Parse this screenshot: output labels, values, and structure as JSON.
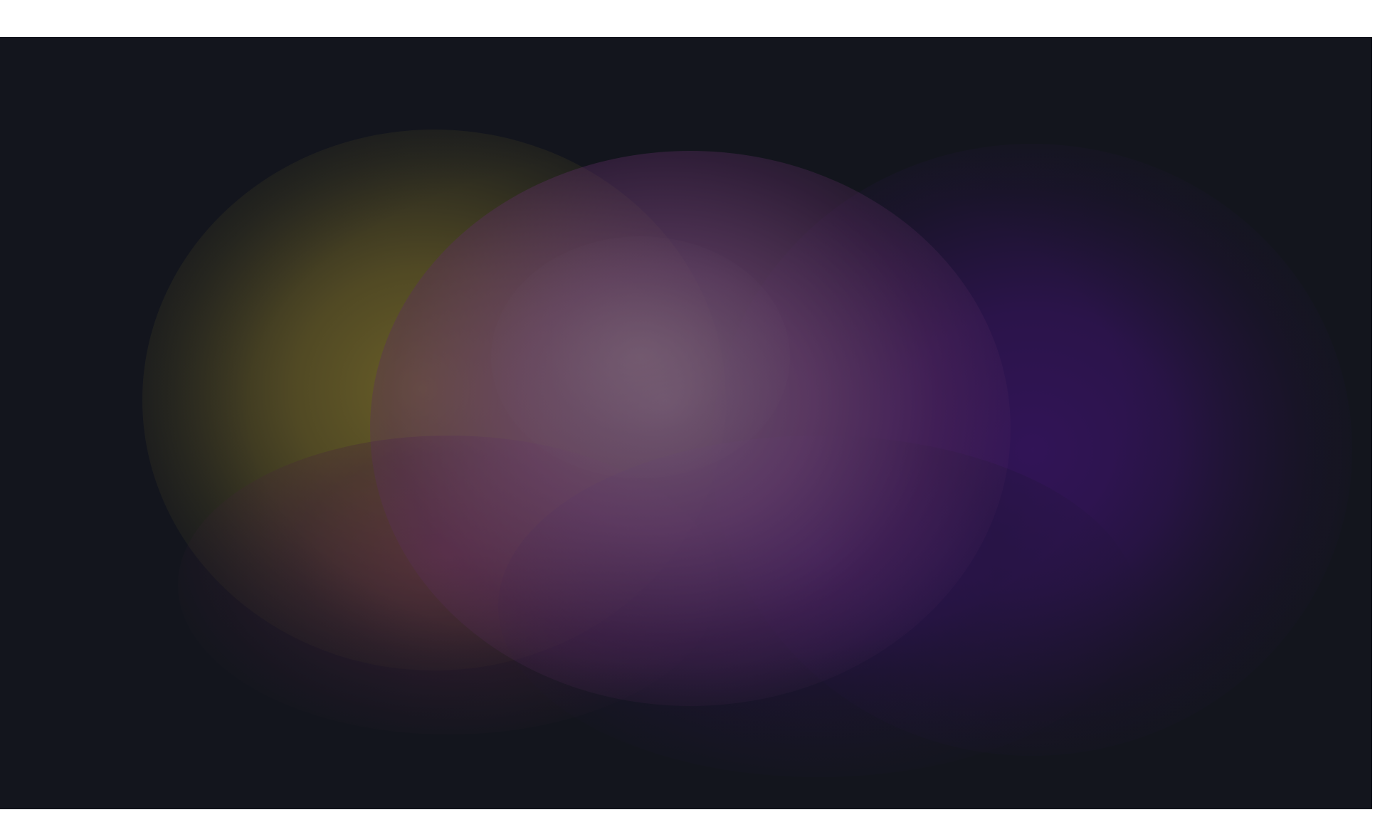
{
  "background": {
    "base_color": "#13151d",
    "margin_color": "#ffffff",
    "gradient_colors": {
      "yellow": "#6e6228",
      "pink": "#765876",
      "purple": "#321458",
      "red": "#602e46"
    }
  }
}
